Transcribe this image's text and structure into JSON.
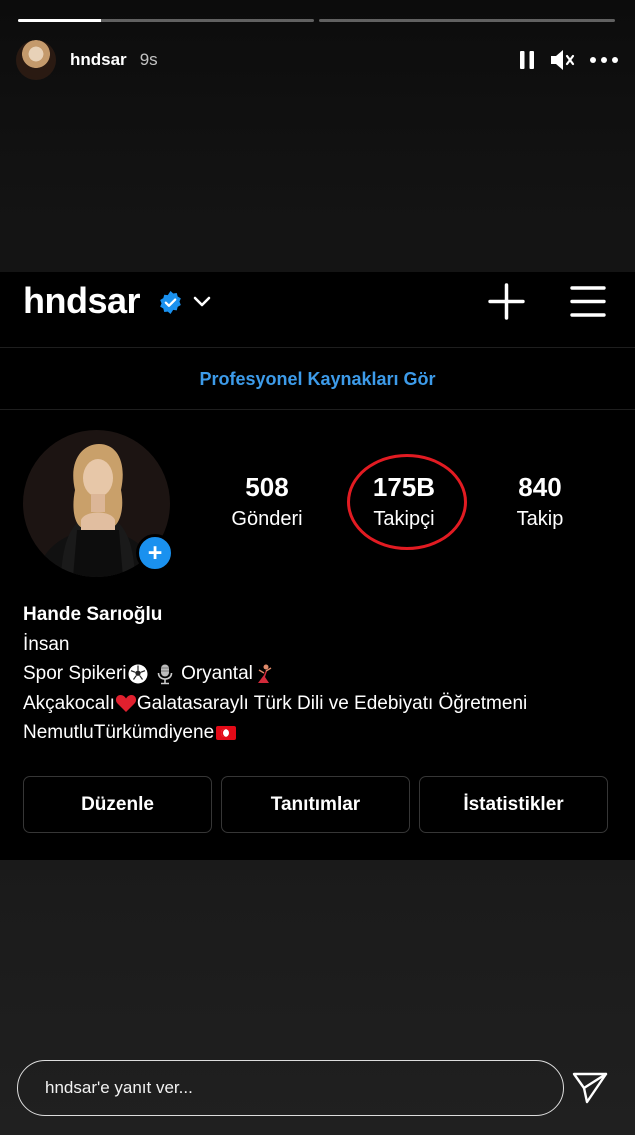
{
  "story": {
    "username": "hndsar",
    "time": "9s",
    "progress_segments": [
      0.28,
      0
    ],
    "controls": {
      "pause_icon": "pause-icon",
      "mute_icon": "mute-icon",
      "more_icon": "more-icon"
    }
  },
  "profile": {
    "username": "hndsar",
    "verified": true,
    "pro_banner": "Profesyonel Kaynakları Gör",
    "stats": [
      {
        "value": "508",
        "label": "Gönderi"
      },
      {
        "value": "175B",
        "label": "Takipçi"
      },
      {
        "value": "840",
        "label": "Takip"
      }
    ],
    "highlighted_stat": "Takipçi",
    "bio": {
      "name": "Hande Sarıoğlu",
      "line1": "İnsan",
      "line2_a": "Spor Spikeri",
      "line2_b": " Oryantal",
      "line3_a": "Akçakocalı",
      "line3_b": "Galatasaraylı Türk Dili ve Edebiyatı Öğretmeni",
      "line4": "NemutluTürkümdiyene"
    },
    "buttons": [
      "Düzenle",
      "Tanıtımlar",
      "İstatistikler"
    ]
  },
  "reply": {
    "placeholder": "hndsar'e yanıt ver..."
  },
  "colors": {
    "accent_blue": "#3d9be9",
    "verified_blue": "#1a91ef",
    "highlight_red": "#e21b22"
  }
}
